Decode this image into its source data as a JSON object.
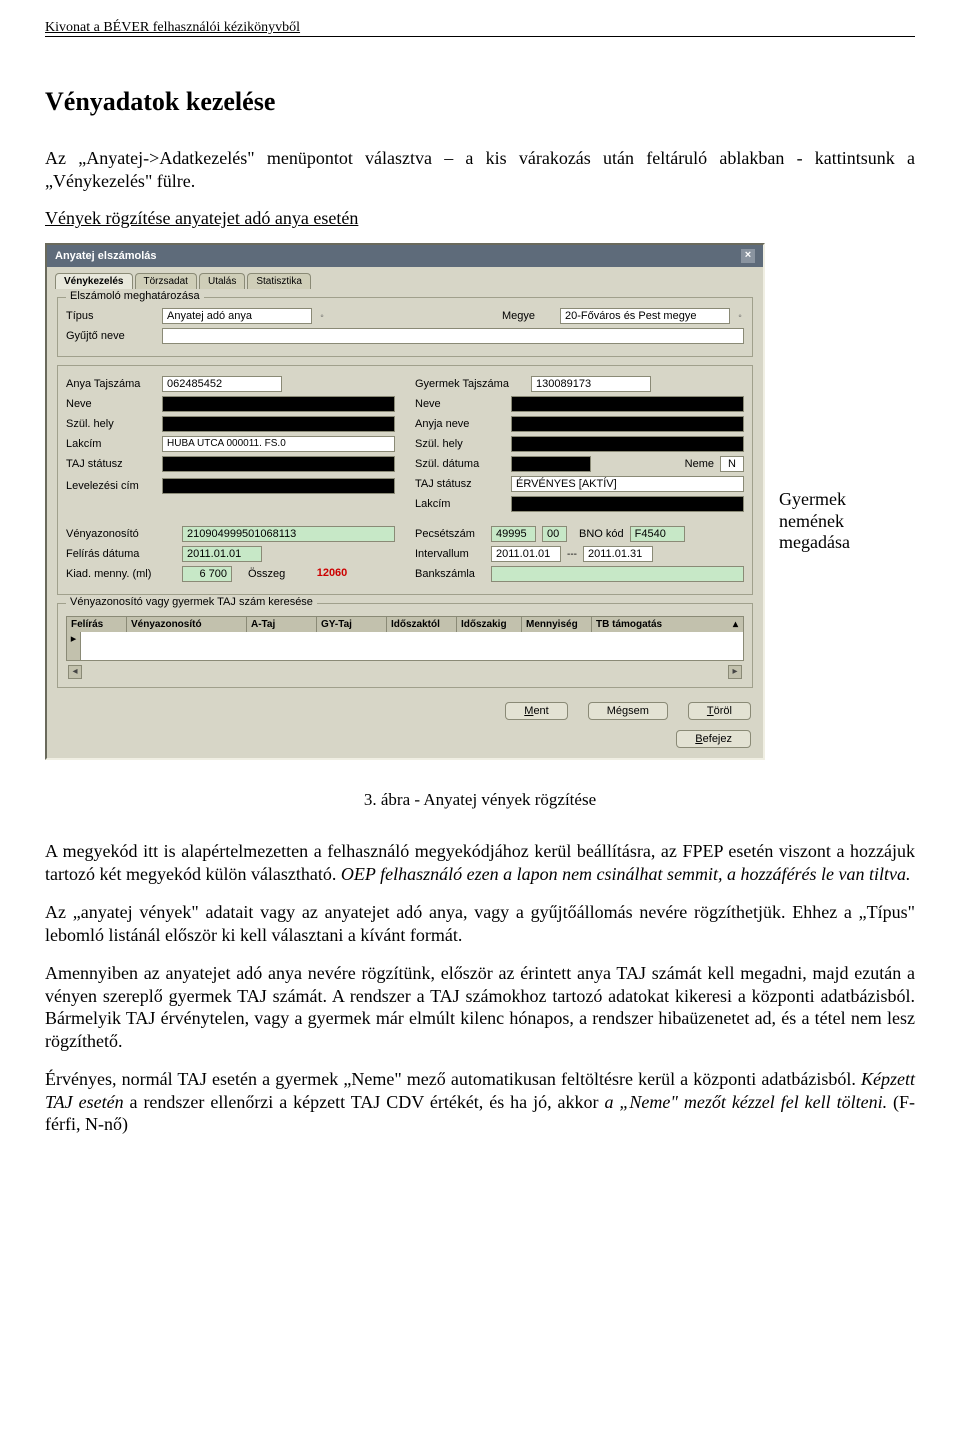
{
  "header": "Kivonat a BÉVER felhasználói kézikönyvből",
  "title": "Vényadatok kezelése",
  "intro": "Az „Anyatej->Adatkezelés\" menüpontot választva – a kis várakozás után feltáruló ablakban - kattintsunk a „Vénykezelés\" fülre.",
  "section_sub": "Vények rögzítése anyatejet adó anya esetén",
  "side_note": {
    "l1": "Gyermek",
    "l2": "nemének",
    "l3": "megadása"
  },
  "caption": "3. ábra - Anyatej vények rögzítése",
  "para1a": "A megyekód itt is alapértelmezetten a felhasználó megyekódjához kerül beállításra, az FPEP esetén viszont a hozzájuk tartozó két megyekód külön választható. ",
  "para1b": "OEP felhasználó ezen a lapon nem csinálhat semmit, a hozzáférés le van tiltva.",
  "para2": "Az „anyatej vények\" adatait vagy az anyatejet adó anya, vagy a gyűjtőállomás nevére rögzíthetjük. Ehhez a „Típus\" lebomló listánál először ki kell választani a kívánt formát.",
  "para3": "Amennyiben az anyatejet adó anya nevére rögzítünk, először az érintett anya TAJ számát kell megadni, majd ezután a vényen szereplő gyermek TAJ számát. A rendszer a TAJ számokhoz tartozó adatokat kikeresi a központi adatbázisból. Bármelyik TAJ érvénytelen, vagy a gyermek már elmúlt kilenc hónapos, a rendszer hibaüzenetet ad, és a tétel nem lesz rögzíthető.",
  "para4a": "Érvényes, normál TAJ esetén a gyermek „Neme\" mező automatikusan feltöltésre kerül a központi adatbázisból. ",
  "para4b": "Képzett TAJ esetén",
  "para4c": " a rendszer ellenőrzi a képzett TAJ CDV értékét, és ha jó, akkor ",
  "para4d": "a „Neme\" mezőt kézzel fel kell tölteni.",
  "para4e": " (F-férfi, N-nő)",
  "app": {
    "title": "Anyatej elszámolás",
    "tabs": [
      "Vénykezelés",
      "Törzsadat",
      "Utalás",
      "Statisztika"
    ],
    "group1": {
      "legend": "Elszámoló meghatározása",
      "tipus_label": "Típus",
      "tipus_value": "Anyatej adó anya",
      "megye_label": "Megye",
      "megye_value": "20-Főváros és Pest megye",
      "gyujto_label": "Gyűjtő neve"
    },
    "anya": {
      "taj_label": "Anya Tajszáma",
      "taj_value": "062485452",
      "neve": "Neve",
      "szulhely": "Szül. hely",
      "lakcim_label": "Lakcím",
      "lakcim_value": "HUBA UTCA 000011. FS.0",
      "taj_status": "TAJ státusz",
      "levelez": "Levelezési cím"
    },
    "gyermek": {
      "taj_label": "Gyermek Tajszáma",
      "taj_value": "130089173",
      "neve": "Neve",
      "anyja": "Anyja neve",
      "szulhely": "Szül. hely",
      "szuldatum": "Szül. dátuma",
      "neme_label": "Neme",
      "neme_value": "N",
      "taj_status_label": "TAJ státusz",
      "taj_status_value": "ÉRVÉNYES [AKTÍV]",
      "lakcim": "Lakcím"
    },
    "veny": {
      "azon_label": "Vényazonosító",
      "azon_value": "210904999501068113",
      "felir_label": "Felírás dátuma",
      "felir_value": "2011.01.01",
      "kiad_label": "Kiad. menny. (ml)",
      "kiad_value": "6 700",
      "osszeg_label": "Összeg",
      "osszeg_value": "12060",
      "pecset_label": "Pecsétszám",
      "pecset_value": "49995",
      "pecset_value2": "00",
      "bno_label": "BNO kód",
      "bno_value": "F4540",
      "interv_label": "Intervallum",
      "interv_from": "2011.01.01",
      "interv_sep": "---",
      "interv_to": "2011.01.31",
      "bank_label": "Bankszámla"
    },
    "search_legend": "Vényazonosító vagy gyermek TAJ szám keresése",
    "cols": [
      "Felírás",
      "Vényazonosító",
      "A-Taj",
      "GY-Taj",
      "Időszaktól",
      "Időszakig",
      "Mennyiség",
      "TB támogatás"
    ],
    "btn_ment": "Ment",
    "btn_megsem": "Mégsem",
    "btn_torol": "Töröl",
    "btn_befejez": "Befejez"
  }
}
